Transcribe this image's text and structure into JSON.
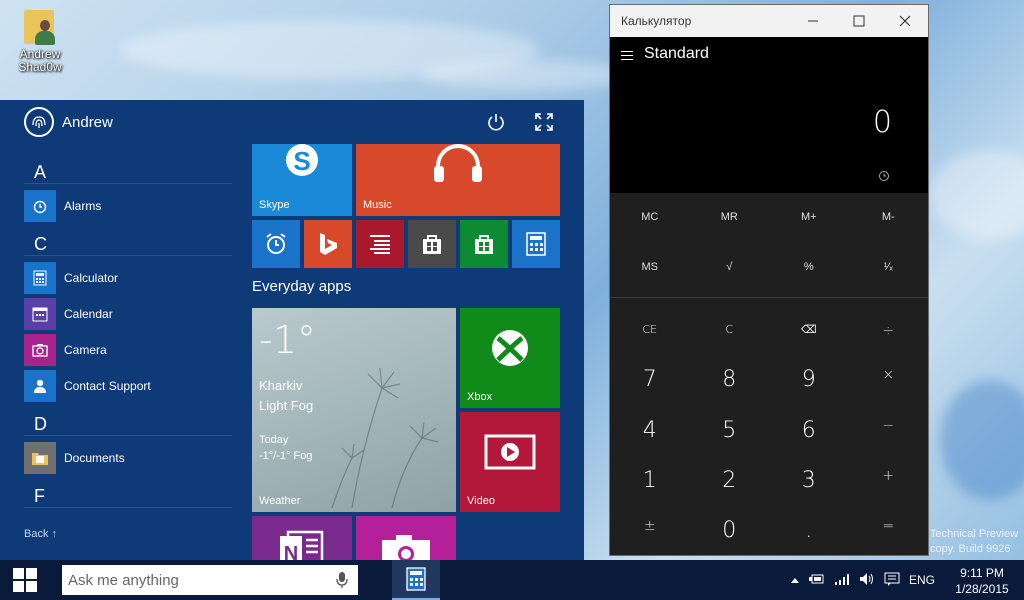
{
  "desktop": {
    "icon_label": "Andrew Shad0w"
  },
  "start": {
    "user_name": "Andrew",
    "back_label": "Back ↑",
    "letters": [
      "A",
      "C",
      "D",
      "F"
    ],
    "apps": [
      {
        "label": "Alarms",
        "color": "#1a72c9"
      },
      {
        "label": "Calculator",
        "color": "#1a72c9"
      },
      {
        "label": "Calendar",
        "color": "#5a3fa6"
      },
      {
        "label": "Camera",
        "color": "#a8238c"
      },
      {
        "label": "Contact Support",
        "color": "#1a72c9"
      },
      {
        "label": "Documents",
        "color": "#707070"
      }
    ],
    "tiles": {
      "skype": "Skype",
      "music": "Music",
      "everyday_apps": "Everyday apps",
      "weather": {
        "temp": "-1°",
        "city": "Kharkiv",
        "cond": "Light Fog",
        "today": "Today",
        "range": "-1°/-1° Fog",
        "label": "Weather"
      },
      "xbox": "Xbox",
      "video": "Video"
    }
  },
  "calculator": {
    "window_title": "Калькулятор",
    "mode": "Standard",
    "display": "0",
    "memory": [
      "MC",
      "MR",
      "M+",
      "M-"
    ],
    "row2": [
      "MS",
      "√",
      "%",
      "¹⁄ₓ"
    ],
    "keys": [
      [
        "CE",
        "C",
        "⌫",
        "÷"
      ],
      [
        "7",
        "8",
        "9",
        "×"
      ],
      [
        "4",
        "5",
        "6",
        "−"
      ],
      [
        "1",
        "2",
        "3",
        "+"
      ],
      [
        "±",
        "0",
        ".",
        "="
      ]
    ]
  },
  "watermark": [
    "Technical Preview",
    "copy. Build 9926"
  ],
  "taskbar": {
    "search_placeholder": "Ask me anything",
    "language": "ENG",
    "time": "9:11 PM",
    "date": "1/28/2015"
  }
}
